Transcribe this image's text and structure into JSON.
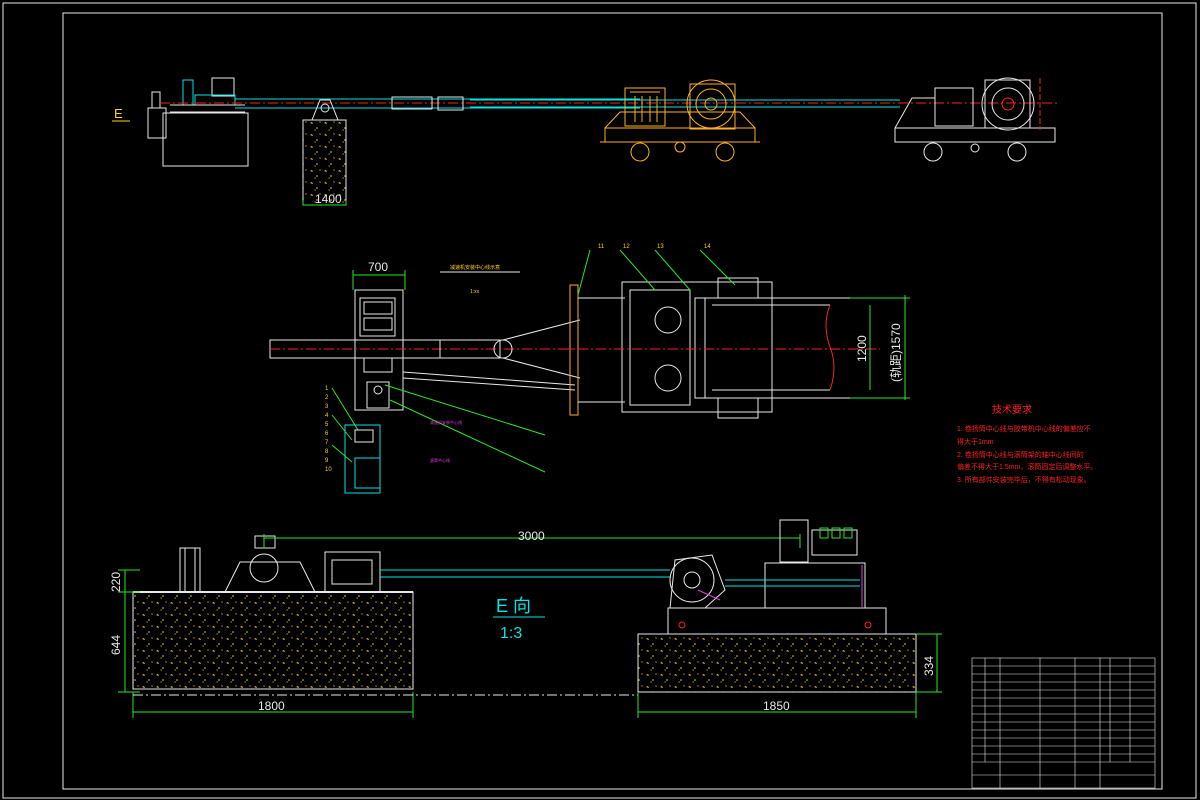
{
  "view_label_top": "E",
  "view_label_e": "E 向",
  "view_scale": "1:3",
  "dims": {
    "d1400": "1400",
    "d700": "700",
    "d1200": "1200",
    "d1570": "(轨距)1570",
    "d3000": "3000",
    "d220": "220",
    "d644": "644",
    "d1800": "1800",
    "d1850": "1850",
    "d334": "334"
  },
  "balloons": [
    "11",
    "12",
    "13",
    "14"
  ],
  "left_balloons": [
    "1",
    "2",
    "3",
    "4",
    "5",
    "6",
    "7",
    "8",
    "9",
    "10"
  ],
  "tech_req": {
    "title": "技术要求",
    "lines": [
      "1. 卷扬筒中心线与胶带机中心线的偏差应不",
      "   得大于1mm",
      "2. 卷扬筒中心线与滚筒架的轴中心线间的",
      "   偏差不得大于1.5mm，滚筒固定后调整水平。",
      "3. 所有部件安装完毕后，不得有松动现象。"
    ]
  },
  "colors": {
    "cyan": "#00e5e5",
    "yellow": "#ffd21a",
    "orange": "#ffb020",
    "red": "#ff2020",
    "green": "#29e629",
    "white": "#e8e8e8",
    "magenta": "#e040e0"
  }
}
